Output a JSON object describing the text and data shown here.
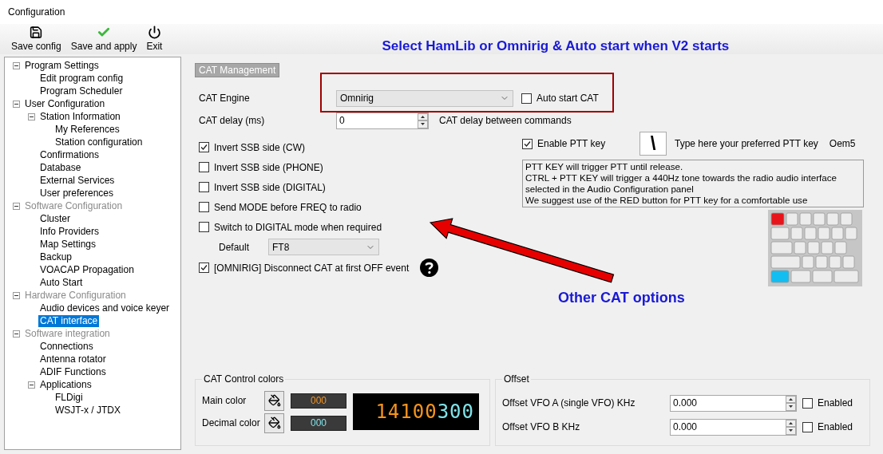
{
  "window": {
    "title": "Configuration"
  },
  "toolbar": [
    {
      "label": "Save config",
      "kind": "save"
    },
    {
      "label": "Save and apply",
      "kind": "apply"
    },
    {
      "label": "Exit",
      "kind": "exit"
    }
  ],
  "annotations": {
    "top_note": "Select HamLib or Omnirig & Auto start when V2 starts",
    "arrow_note": "Other CAT options"
  },
  "tree": [
    {
      "label": "Program Settings",
      "dimmed": false,
      "expanded": true,
      "selected": false,
      "children": [
        {
          "label": "Edit program config",
          "selected": false
        },
        {
          "label": "Program Scheduler",
          "selected": false
        }
      ]
    },
    {
      "label": "User Configuration",
      "dimmed": false,
      "expanded": true,
      "selected": false,
      "children": [
        {
          "label": "Station Information",
          "expanded": true,
          "selected": false,
          "children": [
            {
              "label": "My References",
              "selected": false
            },
            {
              "label": "Station configuration",
              "selected": false
            }
          ]
        },
        {
          "label": "Confirmations",
          "selected": false
        },
        {
          "label": "Database",
          "selected": false
        },
        {
          "label": "External Services",
          "selected": false
        },
        {
          "label": "User preferences",
          "selected": false
        }
      ]
    },
    {
      "label": "Software Configuration",
      "dimmed": true,
      "expanded": true,
      "selected": false,
      "children": [
        {
          "label": "Cluster",
          "selected": false
        },
        {
          "label": "Info Providers",
          "selected": false
        },
        {
          "label": "Map Settings",
          "selected": false
        },
        {
          "label": "Backup",
          "selected": false
        },
        {
          "label": "VOACAP Propagation",
          "selected": false
        },
        {
          "label": "Auto Start",
          "selected": false
        }
      ]
    },
    {
      "label": "Hardware Configuration",
      "dimmed": true,
      "expanded": true,
      "selected": false,
      "children": [
        {
          "label": "Audio devices and voice keyer",
          "selected": false
        },
        {
          "label": "CAT interface",
          "selected": true
        }
      ]
    },
    {
      "label": "Software integration",
      "dimmed": true,
      "expanded": true,
      "selected": false,
      "children": [
        {
          "label": "Connections",
          "selected": false
        },
        {
          "label": "Antenna rotator",
          "selected": false
        },
        {
          "label": "ADIF Functions",
          "selected": false
        },
        {
          "label": "Applications",
          "expanded": true,
          "selected": false,
          "children": [
            {
              "label": "FLDigi",
              "selected": false
            },
            {
              "label": "WSJT-x / JTDX",
              "selected": false
            }
          ]
        }
      ]
    }
  ],
  "cat_management": {
    "title": "CAT Management",
    "engine": {
      "label": "CAT Engine",
      "value": "Omnirig"
    },
    "auto_start": {
      "label": "Auto start CAT",
      "checked": false
    },
    "delay": {
      "label": "CAT delay (ms)",
      "value": "0",
      "hint": "CAT delay between commands"
    },
    "options": [
      {
        "label": "Invert SSB side (CW)",
        "checked": true
      },
      {
        "label": "Invert SSB side (PHONE)",
        "checked": false
      },
      {
        "label": "Invert SSB side (DIGITAL)",
        "checked": false
      },
      {
        "label": "Send MODE before FREQ to radio",
        "checked": false
      },
      {
        "label": "Switch to DIGITAL mode when required",
        "checked": false
      }
    ],
    "default_mode": {
      "label": "Default",
      "value": "FT8"
    },
    "disconnect": {
      "label": "[OMNIRIG] Disconnect CAT at first OFF event",
      "checked": true
    }
  },
  "ptt": {
    "enable": {
      "label": "Enable PTT key",
      "checked": true
    },
    "key": "\\",
    "hint": "Type here your preferred PTT key",
    "key_name": "Oem5",
    "info": [
      "PTT KEY will trigger PTT until release.",
      "CTRL + PTT KEY will trigger a 440Hz tone towards the radio audio interface",
      "selected in the Audio Configuration panel",
      "We suggest use of the RED button for PTT key for a comfortable use"
    ]
  },
  "colors": {
    "title": "CAT Control colors",
    "rows": [
      {
        "label": "Main color",
        "value": "000",
        "color": "#f7941d"
      },
      {
        "label": "Decimal color",
        "value": "000",
        "color": "#7fe3e8"
      }
    ],
    "display": {
      "main": "14100",
      "decimal": "300"
    }
  },
  "offset": {
    "title": "Offset",
    "rows": [
      {
        "label": "Offset VFO A (single VFO) KHz",
        "value": "0.000",
        "enabled_label": "Enabled",
        "checked": false
      },
      {
        "label": "Offset VFO B KHz",
        "value": "0.000",
        "enabled_label": "Enabled",
        "checked": false
      }
    ]
  }
}
